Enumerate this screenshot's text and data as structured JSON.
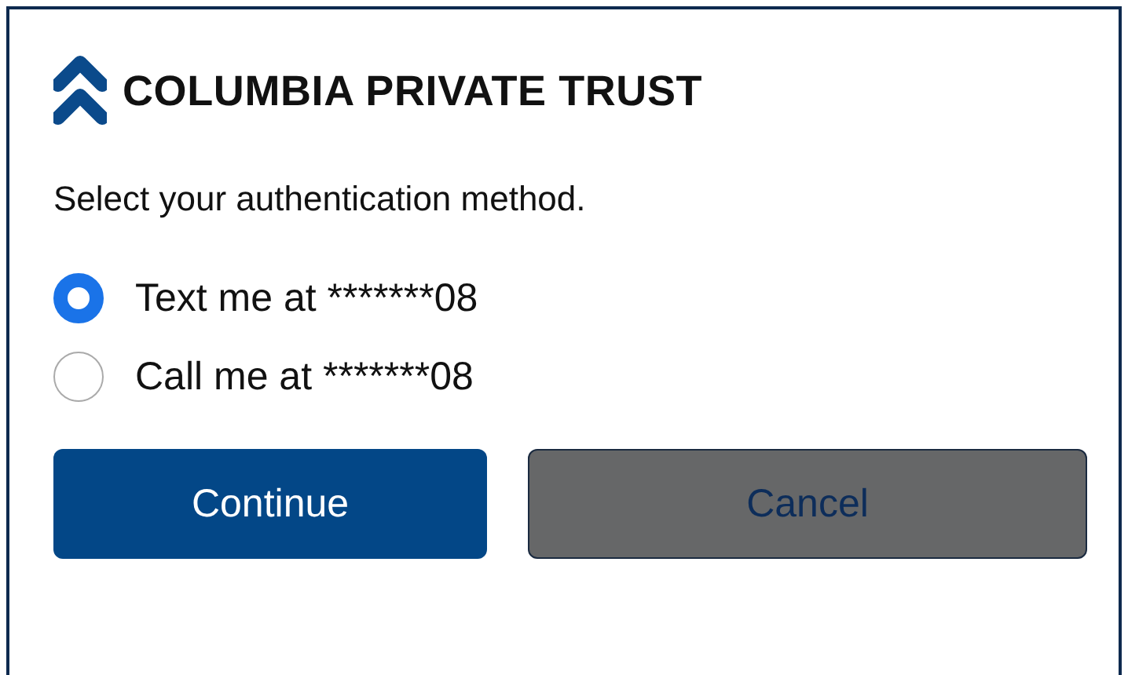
{
  "brand": {
    "name": "COLUMBIA PRIVATE TRUST"
  },
  "prompt": "Select your authentication method.",
  "options": [
    {
      "label": "Text me at *******08",
      "selected": true
    },
    {
      "label": "Call me at *******08",
      "selected": false
    }
  ],
  "buttons": [
    {
      "label": "Continue",
      "kind": "primary"
    },
    {
      "label": "Cancel",
      "kind": "secondary"
    }
  ]
}
